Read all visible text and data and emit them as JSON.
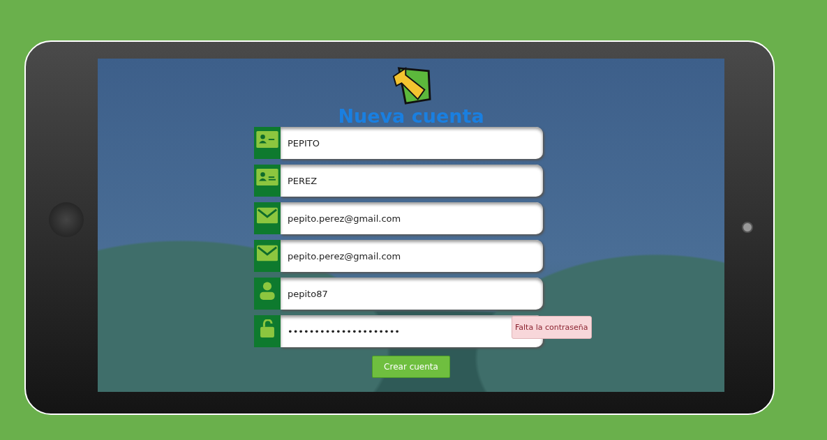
{
  "title": "Nueva cuenta",
  "fields": [
    {
      "kind": "name",
      "value": "PEPITO"
    },
    {
      "kind": "surname",
      "value": "PEREZ"
    },
    {
      "kind": "email",
      "value": "pepito.perez@gmail.com"
    },
    {
      "kind": "email",
      "value": "pepito.perez@gmail.com"
    },
    {
      "kind": "user",
      "value": "pepito87"
    },
    {
      "kind": "lock",
      "value": "•••••••••••••••••••••",
      "error": "Falta la contraseña"
    }
  ],
  "submit": "Crear cuenta"
}
